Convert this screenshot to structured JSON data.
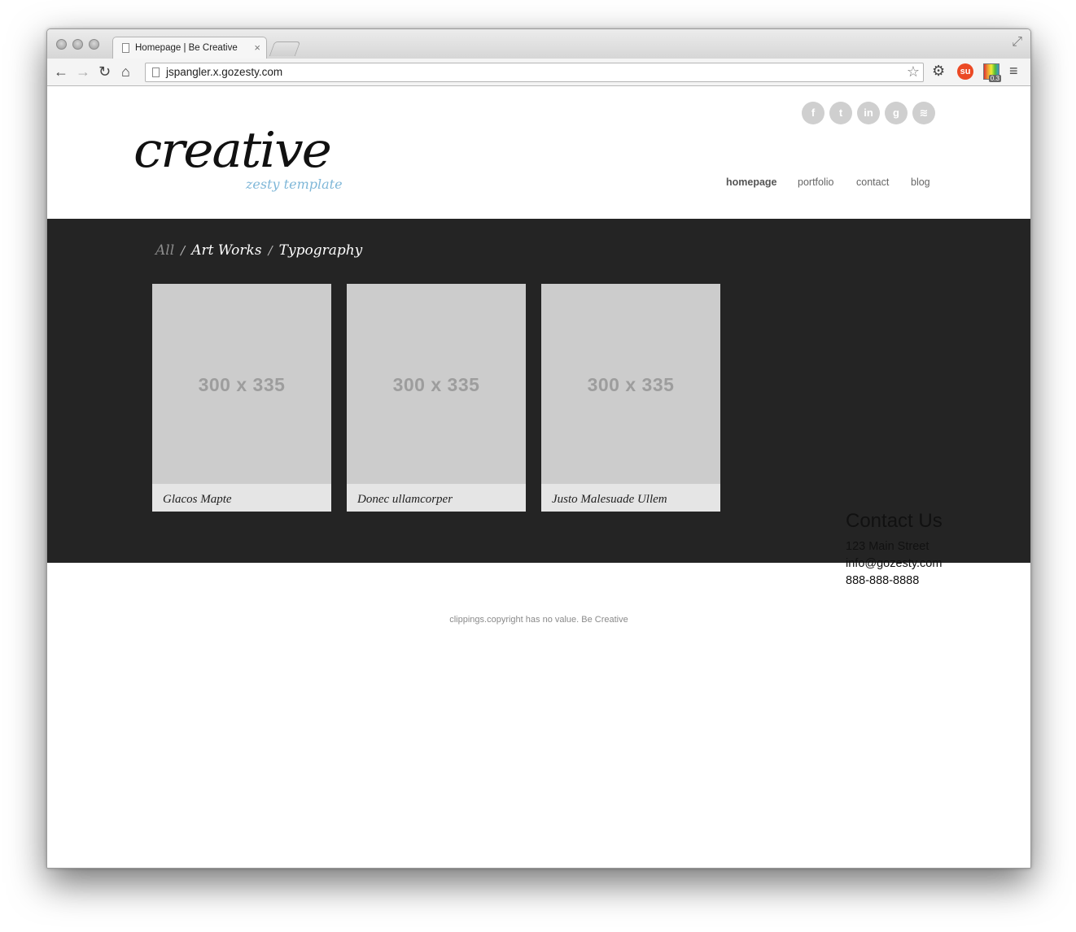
{
  "browser": {
    "tab_title": "Homepage | Be Creative",
    "tab_close": "×",
    "url": "jspangler.x.gozesty.com",
    "back_glyph": "←",
    "forward_glyph": "→",
    "reload_glyph": "↻",
    "home_glyph": "⌂",
    "star_glyph": "☆",
    "gear_glyph": "⚙",
    "menu_glyph": "≡",
    "fullscreen_glyph": "⤢",
    "extension_badge": "0.3"
  },
  "site": {
    "logo_main": "creative",
    "logo_sub": "zesty template",
    "social": [
      {
        "icon": "facebook-icon",
        "glyph": "f"
      },
      {
        "icon": "twitter-icon",
        "glyph": "t"
      },
      {
        "icon": "linkedin-icon",
        "glyph": "in"
      },
      {
        "icon": "google-icon",
        "glyph": "g"
      },
      {
        "icon": "rss-icon",
        "glyph": "≋"
      }
    ],
    "nav": [
      {
        "label": "homepage",
        "active": true
      },
      {
        "label": "portfolio",
        "active": false
      },
      {
        "label": "contact",
        "active": false
      },
      {
        "label": "blog",
        "active": false
      }
    ]
  },
  "portfolio": {
    "filters": [
      "All",
      "Art Works",
      "Typography"
    ],
    "separator": "/",
    "items": [
      {
        "placeholder": "300 x 335",
        "caption": "Glacos Mapte"
      },
      {
        "placeholder": "300 x 335",
        "caption": "Donec ullamcorper"
      },
      {
        "placeholder": "300 x 335",
        "caption": "Justo Malesuade Ullem"
      }
    ]
  },
  "contact": {
    "title": "Contact Us",
    "address": "123 Main Street",
    "email": "info@gozesty.com",
    "phone": "888-888-8888"
  },
  "footer": {
    "copyright": "clippings.copyright has no value. Be Creative"
  },
  "colors": {
    "band": "#242424",
    "placeholder": "#cccccc",
    "accent_logo_sub": "#7fb7d8"
  }
}
